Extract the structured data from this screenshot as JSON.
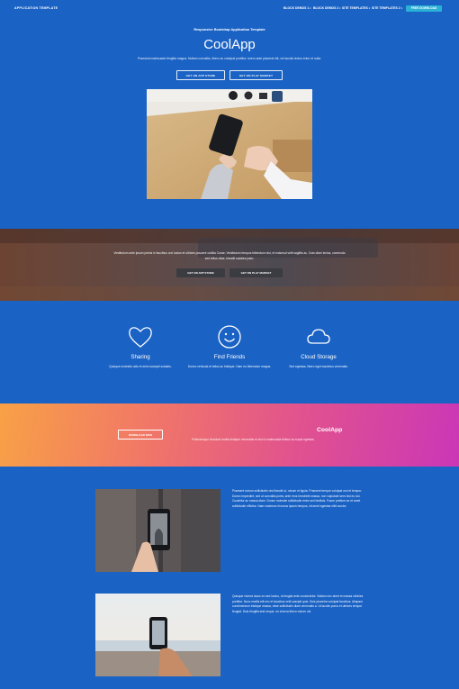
{
  "nav": {
    "brand": "APPLICATION TEMPLATE",
    "items": [
      "BLOCK DEMOS 1",
      "BLOCK DEMOS 2",
      "SITE TEMPLATES",
      "SITE TEMPLATES 2"
    ],
    "download": "FREE DOWNLOAD"
  },
  "hero": {
    "subtitle": "Responsive Bootstrap Application Template",
    "title": "CoolApp",
    "lead": "Praesent malesuada fringilla magna. Nullam convallis, libero ac volutpat porttitor, lorem ante placerat elit, vel iaculis lectus enim et nulla.",
    "app_store": "GET ON APP STORE",
    "play_market": "GET ON PLAY MARKET"
  },
  "band": {
    "text": "Vestibulum ante ipsum primis in faucibus orci luctus et ultrices posuere cubilia Curae; Vestibulum tempus bibendum nisi, et euismod velit sagittis ac. Cras diam lectus, commodo sed tellus vitae, blandit sodales justo.",
    "app_store": "GET ON APP STORE",
    "play_market": "GET ON PLAY MARKET"
  },
  "features": [
    {
      "icon": "heart-icon",
      "title": "Sharing",
      "text": "Quisque molestie odio et enim suscipit sodales."
    },
    {
      "icon": "smiley-icon",
      "title": "Find Friends",
      "text": "Donec vehicula et tellus ac tristique. Nam eu bibendum magna."
    },
    {
      "icon": "cloud-icon",
      "title": "Cloud Storage",
      "text": "Sed egestas, libero eget maximus venenatis."
    }
  ],
  "promo": {
    "button": "DOWNLOAD NOW",
    "title": "CoolApp",
    "text": "Pellentesque tincidunt mollis tristique venenatis et nisi ut malesuada finibus ac turpis egestas."
  },
  "rows": [
    {
      "text": "Praesent rutrum sollicitudin nisi blandit ut, rutrum et ligula. Praesent tempor volutpat orci et tempor. Donec imperdiet, sed ut convallis porta, ante eros hendrerit massa, non vulputate sem nisl eu dui. Curabitur ac massa diam. Donec molestie sollicitudin enim sed facilisis. Fusce pretium ac et amet sollicitudin efficitur. Nam maximus rhoncus ipsum tempus, sit amet egestas nibh auctor."
    },
    {
      "text": "Quisque viverra lacus ex sed luctus, ut feugiat ante consectetur. Nullam nec amet et massa ultricies porttitor. Nunc mattis elit nec et faucibus velit suscipit quis. Duis pharetra volutpat faucibus. Aliquam condimentum tristique massa, vitae sollicitudin diam venenatis a. Ut iaculis purus et ultrices tempor feugiat. Duis fringilla erat neque, eu viverra libero rutrum vel."
    }
  ],
  "colors": {
    "page": "#1a62c4",
    "download": "#2bb0d6"
  }
}
